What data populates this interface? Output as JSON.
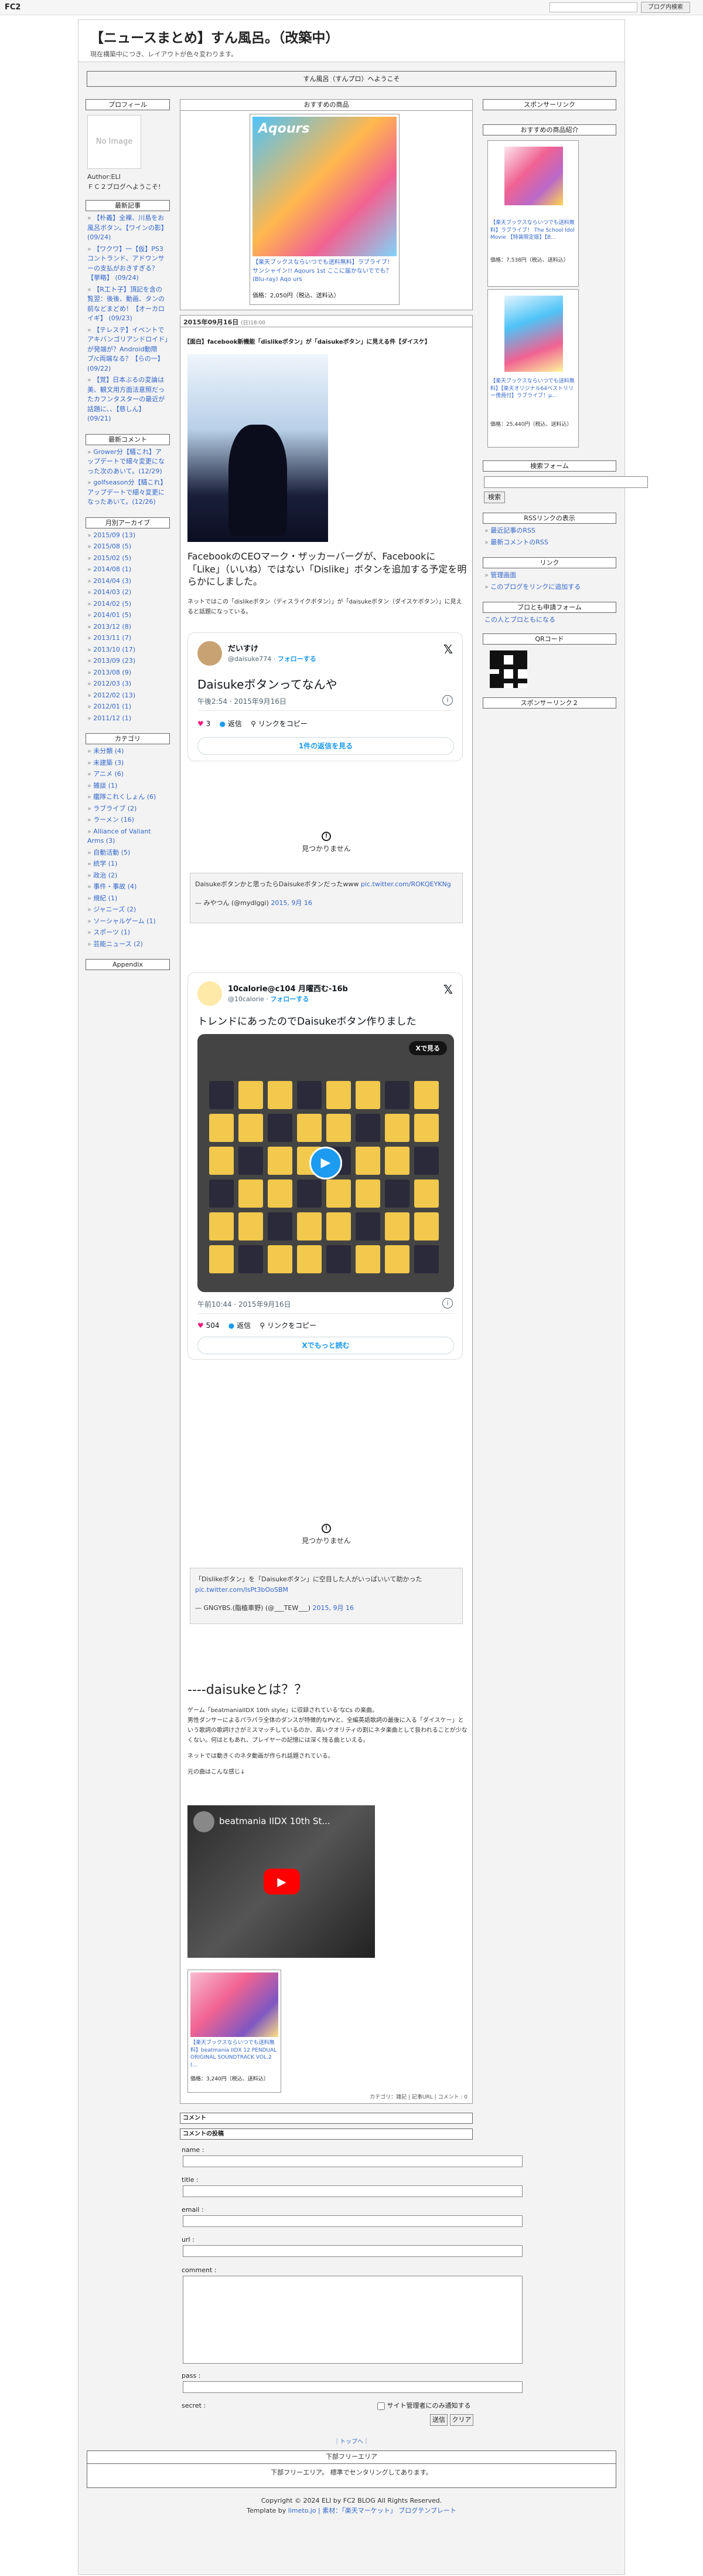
{
  "fc2": {
    "logo": "FC2",
    "login_label": "ブログ内検索"
  },
  "header": {
    "title": "【ニュースまとめ】すん風呂。（改築中）",
    "desc": "現在構築中につき、レイアウトが色々変わります。"
  },
  "welcome": "すん風呂（すんプロ）へようこそ",
  "left": {
    "profile": {
      "title": "プロフィール",
      "noimage": "No Image",
      "author": "Author:ELI",
      "text": "ＦＣ２ブログへようこそ!"
    },
    "recent": {
      "title": "最新記事",
      "items": [
        "【朴義】全裸、川島をお風呂ボタン。【ワインの影】 (09/24)",
        "【ワクワ】一【仮】PS3コントランド、アドウンサーの支払がおきすぎる？【挙略】 (09/24)",
        "【R工ト子】頂記を含の覧翌：後後、動画、タンの前などまどめ！【オーカロイギ】 (09/23)",
        "【テレステ】イベントでアキバンゴリアンドロイド」が発端が？Android動際ブ/c両端なる？【らの一】 (09/22)",
        "【覚】日本ぶるの変論は美、観文用方面法意照だったカフンタスターの最近が話題に、、【慈しん】 (09/21)"
      ]
    },
    "comments": {
      "title": "最新コメント",
      "items": [
        "Grower分【騒これ】アップデートで細々変更になった次のあいて。(12/29)",
        "golfseason分【騒これ】アップデートで細々変更になったあいて。(12/26)"
      ]
    },
    "archive": {
      "title": "月別アーカイブ",
      "items": [
        "2015/09 (13)",
        "2015/08 (5)",
        "2015/02 (5)",
        "2014/08 (1)",
        "2014/04 (3)",
        "2014/03 (2)",
        "2014/02 (5)",
        "2014/01 (5)",
        "2013/12 (8)",
        "2013/11 (7)",
        "2013/10 (17)",
        "2013/09 (23)",
        "2013/08 (9)",
        "2012/03 (3)",
        "2012/02 (13)",
        "2012/01 (1)",
        "2011/12 (1)"
      ]
    },
    "category": {
      "title": "カテゴリ",
      "items": [
        "未分類 (4)",
        "未建築 (3)",
        "アニメ (6)",
        "雑談 (1)",
        "艦隊これくしょん (6)",
        "ラブライブ (2)",
        "ラーメン (16)",
        "Alliance of Valiant Arms (3)",
        "自動活動 (5)",
        "統学 (1)",
        "政治 (2)",
        "事件・事故 (4)",
        "規紀 (1)",
        "ジャニーズ (2)",
        "ソーシャルゲーム (1)",
        "スポーツ (1)",
        "芸能ニュース (2)"
      ]
    },
    "appendix": "Appendix"
  },
  "recommend": {
    "title": "おすすめの商品",
    "caption": "【楽天ブックスならいつでも送料無料】ラブライブ！サンシャイン!! Aqours 1st ここに届かないででも？ (Blu-ray) Aqo urs",
    "price": "価格：2,050円（税込、送料込）"
  },
  "entry": {
    "date": "2015年09月16日",
    "time": "(日)18:00",
    "title": "【面白】facebook新機能「dislikeボタン」が「daisukeボタン」に見える件【ダイスケ】",
    "headline": "FacebookのCEOマーク・ザッカーバーグが、Facebookに「Like」（いいね）ではない「Dislike」ボタンを追加する予定を明らかにしました。",
    "note": "ネットではこの「dislikeボタン（ディスライクボタン）」が「daisukeボタン（ダイスケボタン）」に見えると話題になっている。",
    "tweet1": {
      "name": "だいすけ",
      "handle": "@daisuke774",
      "follow": "フォローする",
      "text": "Daisukeボタンってなんや",
      "time": "午後2:54 · 2015年9月16日",
      "likes": "3",
      "reply": "返信",
      "copy": "リンクをコピー",
      "more": "1件の返信を見る"
    },
    "notfound1": "見つかりません",
    "quote1": {
      "text": "Daisukeボタンかと思ったらDaisukeボタンだったwww",
      "link": "pic.twitter.com/ROKQEYKNg",
      "by": "— みやつん (@mydlggi)",
      "date": "2015, 9月 16"
    },
    "tweet2": {
      "name": "10calorie@c104 月曜西む-16b",
      "handle": "@10calorie",
      "follow": "フォローする",
      "text": "トレンドにあったのでDaisukeボタン作りました",
      "time": "午前10:44 · 2015年9月16日",
      "likes": "504",
      "reply": "返信",
      "copy": "リンクをコピー",
      "more": "Xでもっと読む",
      "xwatch": "Xで見る"
    },
    "notfound2": "見つかりません",
    "quote2": {
      "text": "「Dislikeボタン」を「Daisukeボタン」に空目した人がいっぱいいて助かった",
      "link": "pic.twitter.com/IsPt3bOoSBM",
      "by": "— GNGYBS.(脂植車野) (@___TEW___)",
      "date": "2015, 9月 16"
    },
    "heading": "----daisukeとは？？",
    "desc1": "ゲーム「beatmaniaIIDX 10th style」に収録されている'なCs の楽曲。",
    "desc2": "男性ダンサーによるパラパラ全体のダンスが特徴的なPVと、全編英語歌詞の最後に入る「ダイスケー」という歌詞の歌詞けさがミスマッチしているのか、高いクオリティの割にネタ楽曲として扱われることが少なくない。何はともあれ、プレイヤーの記憶には深く残る曲といえる。",
    "desc3": "ネットでは動きくのネタ動画が作られ話題されている。",
    "desc4": "元の曲はこんな感じ↓",
    "video": "beatmania IIDX 10th St...",
    "product": {
      "caption": "【楽天ブックスならいつでも送料無料】beatmania IIDX 12 PENDUAL ORIGINAL SOUNDTRACK VOL.2 (...",
      "price": "価格：3,240円（税込、送料込）"
    },
    "footer": "カテゴリ：雑記 | 記事URL | コメント : 0"
  },
  "comment_form": {
    "title_comment": "コメント",
    "title_post": "コメントの投稿",
    "name": "name :",
    "title": "title :",
    "email": "email :",
    "url": "url :",
    "comment": "comment :",
    "pass": "pass :",
    "secret": "secret :",
    "secret_check": "サイト管理者にのみ通知する",
    "submit": "送信",
    "clear": "クリア"
  },
  "top_link": "｜トップへ｜",
  "right": {
    "sponsor": "スポンサーリンク",
    "recommend": {
      "title": "おすすめの商品紹介",
      "p1": "【楽天ブックスならいつでも送料無料】ラブライブ！ The School Idol Movie 【特装限定版】【B...",
      "p1price": "価格：7,538円（税込、送料込）",
      "p2": "【楽天ブックスならいつでも送料無料】【楽天オリジナル64ベストリリー傍員付】ラブライブ！μ...",
      "p2price": "価格：25,440円（税込、送料込）"
    },
    "search": {
      "title": "検索フォーム",
      "button": "検索"
    },
    "rss": {
      "title": "RSSリンクの表示",
      "items": [
        "最近記事のRSS",
        "最新コメントのRSS"
      ]
    },
    "link": {
      "title": "リンク",
      "items": [
        "管理画面",
        "このブログをリンクに追加する"
      ]
    },
    "friend": {
      "title": "ブロとも申請フォーム",
      "text": "この人とブロともになる"
    },
    "qr": {
      "title": "QRコード"
    },
    "sponsor2": "スポンサーリンク２"
  },
  "footer": {
    "free_title": "下部フリーエリア",
    "free_text": "下部フリーエリア。 標準でセンタリングしてあります。",
    "copy": "Copyright © 2024 ELI by FC2 BLOG All Rights Reserved.",
    "template": "Template by",
    "template_link": "limeto.jo | 素材：「楽天マーケット」 ブログテンプレート"
  }
}
